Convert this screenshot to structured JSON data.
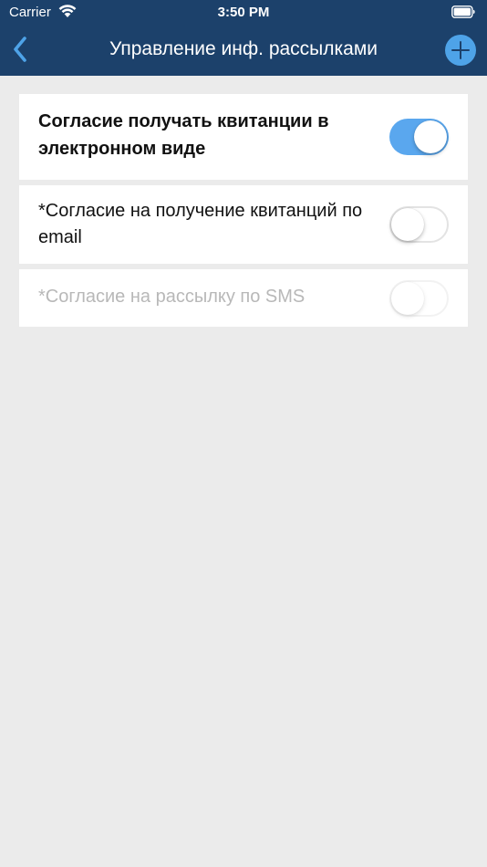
{
  "status_bar": {
    "carrier": "Carrier",
    "time": "3:50 PM",
    "wifi_icon": "wifi-icon",
    "battery_icon": "battery-icon"
  },
  "nav_bar": {
    "title": "Управление инф. рассылками",
    "back_icon": "chevron-left-icon",
    "add_icon": "plus-icon"
  },
  "colors": {
    "nav_background": "#1c416b",
    "accent": "#4ea3e8",
    "toggle_on": "#5aa7ee",
    "background": "#ebebeb",
    "disabled_text": "#b8b8b8"
  },
  "settings": [
    {
      "label": "Согласие получать квитанции в электронном виде",
      "enabled": true,
      "disabled": false
    },
    {
      "label": "*Согласие на получение квитанций по email",
      "enabled": false,
      "disabled": false
    },
    {
      "label": "*Согласие на рассылку по SMS",
      "enabled": false,
      "disabled": true
    }
  ]
}
